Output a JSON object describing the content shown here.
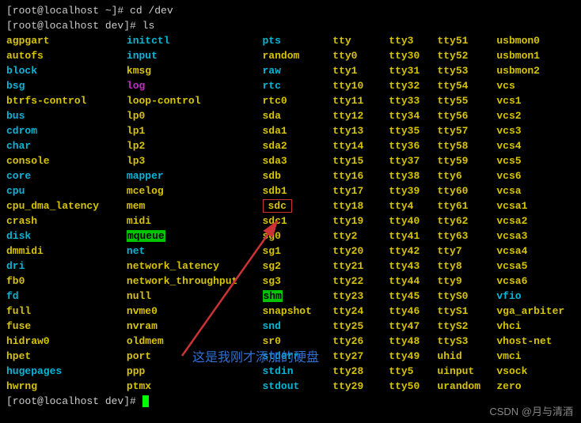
{
  "prompts": [
    {
      "prefix": "[root@localhost ~]# ",
      "cmd": "cd /dev"
    },
    {
      "prefix": "[root@localhost dev]# ",
      "cmd": "ls"
    }
  ],
  "final_prompt": "[root@localhost dev]# ",
  "columns": [
    [
      {
        "t": "agpgart",
        "c": "yellow"
      },
      {
        "t": "autofs",
        "c": "yellow"
      },
      {
        "t": "block",
        "c": "cyan"
      },
      {
        "t": "bsg",
        "c": "cyan"
      },
      {
        "t": "btrfs-control",
        "c": "yellow"
      },
      {
        "t": "bus",
        "c": "cyan"
      },
      {
        "t": "cdrom",
        "c": "cyan"
      },
      {
        "t": "char",
        "c": "cyan"
      },
      {
        "t": "console",
        "c": "yellow"
      },
      {
        "t": "core",
        "c": "cyan"
      },
      {
        "t": "cpu",
        "c": "cyan"
      },
      {
        "t": "cpu_dma_latency",
        "c": "yellow"
      },
      {
        "t": "crash",
        "c": "yellow"
      },
      {
        "t": "disk",
        "c": "cyan"
      },
      {
        "t": "dmmidi",
        "c": "yellow"
      },
      {
        "t": "dri",
        "c": "cyan"
      },
      {
        "t": "fb0",
        "c": "yellow"
      },
      {
        "t": "fd",
        "c": "cyan"
      },
      {
        "t": "full",
        "c": "yellow"
      },
      {
        "t": "fuse",
        "c": "yellow"
      },
      {
        "t": "hidraw0",
        "c": "yellow"
      },
      {
        "t": "hpet",
        "c": "yellow"
      },
      {
        "t": "hugepages",
        "c": "cyan"
      },
      {
        "t": "hwrng",
        "c": "yellow"
      }
    ],
    [
      {
        "t": "initctl",
        "c": "cyan"
      },
      {
        "t": "input",
        "c": "cyan"
      },
      {
        "t": "kmsg",
        "c": "yellow"
      },
      {
        "t": "log",
        "c": "magenta"
      },
      {
        "t": "loop-control",
        "c": "yellow"
      },
      {
        "t": "lp0",
        "c": "yellow"
      },
      {
        "t": "lp1",
        "c": "yellow"
      },
      {
        "t": "lp2",
        "c": "yellow"
      },
      {
        "t": "lp3",
        "c": "yellow"
      },
      {
        "t": "mapper",
        "c": "cyan"
      },
      {
        "t": "mcelog",
        "c": "yellow"
      },
      {
        "t": "mem",
        "c": "yellow"
      },
      {
        "t": "midi",
        "c": "yellow"
      },
      {
        "t": "mqueue",
        "c": "green-bg"
      },
      {
        "t": "net",
        "c": "cyan"
      },
      {
        "t": "network_latency",
        "c": "yellow"
      },
      {
        "t": "network_throughput",
        "c": "yellow"
      },
      {
        "t": "null",
        "c": "yellow"
      },
      {
        "t": "nvme0",
        "c": "yellow"
      },
      {
        "t": "nvram",
        "c": "yellow"
      },
      {
        "t": "oldmem",
        "c": "yellow"
      },
      {
        "t": "port",
        "c": "yellow"
      },
      {
        "t": "ppp",
        "c": "yellow"
      },
      {
        "t": "ptmx",
        "c": "yellow"
      }
    ],
    [
      {
        "t": "pts",
        "c": "cyan"
      },
      {
        "t": "random",
        "c": "yellow"
      },
      {
        "t": "raw",
        "c": "cyan"
      },
      {
        "t": "rtc",
        "c": "cyan"
      },
      {
        "t": "rtc0",
        "c": "yellow"
      },
      {
        "t": "sda",
        "c": "yellow"
      },
      {
        "t": "sda1",
        "c": "yellow"
      },
      {
        "t": "sda2",
        "c": "yellow"
      },
      {
        "t": "sda3",
        "c": "yellow"
      },
      {
        "t": "sdb",
        "c": "yellow"
      },
      {
        "t": "sdb1",
        "c": "yellow"
      },
      {
        "t": "sdc",
        "c": "sdc-box"
      },
      {
        "t": "sdc1",
        "c": "yellow"
      },
      {
        "t": "sg0",
        "c": "yellow"
      },
      {
        "t": "sg1",
        "c": "yellow"
      },
      {
        "t": "sg2",
        "c": "yellow"
      },
      {
        "t": "sg3",
        "c": "yellow"
      },
      {
        "t": "shm",
        "c": "green-bg"
      },
      {
        "t": "snapshot",
        "c": "yellow"
      },
      {
        "t": "snd",
        "c": "cyan"
      },
      {
        "t": "sr0",
        "c": "yellow"
      },
      {
        "t": "stderr",
        "c": "cyan"
      },
      {
        "t": "stdin",
        "c": "cyan"
      },
      {
        "t": "stdout",
        "c": "cyan"
      }
    ],
    [
      {
        "t": "tty",
        "c": "yellow"
      },
      {
        "t": "tty0",
        "c": "yellow"
      },
      {
        "t": "tty1",
        "c": "yellow"
      },
      {
        "t": "tty10",
        "c": "yellow"
      },
      {
        "t": "tty11",
        "c": "yellow"
      },
      {
        "t": "tty12",
        "c": "yellow"
      },
      {
        "t": "tty13",
        "c": "yellow"
      },
      {
        "t": "tty14",
        "c": "yellow"
      },
      {
        "t": "tty15",
        "c": "yellow"
      },
      {
        "t": "tty16",
        "c": "yellow"
      },
      {
        "t": "tty17",
        "c": "yellow"
      },
      {
        "t": "tty18",
        "c": "yellow"
      },
      {
        "t": "tty19",
        "c": "yellow"
      },
      {
        "t": "tty2",
        "c": "yellow"
      },
      {
        "t": "tty20",
        "c": "yellow"
      },
      {
        "t": "tty21",
        "c": "yellow"
      },
      {
        "t": "tty22",
        "c": "yellow"
      },
      {
        "t": "tty23",
        "c": "yellow"
      },
      {
        "t": "tty24",
        "c": "yellow"
      },
      {
        "t": "tty25",
        "c": "yellow"
      },
      {
        "t": "tty26",
        "c": "yellow"
      },
      {
        "t": "tty27",
        "c": "yellow"
      },
      {
        "t": "tty28",
        "c": "yellow"
      },
      {
        "t": "tty29",
        "c": "yellow"
      }
    ],
    [
      {
        "t": "tty3",
        "c": "yellow"
      },
      {
        "t": "tty30",
        "c": "yellow"
      },
      {
        "t": "tty31",
        "c": "yellow"
      },
      {
        "t": "tty32",
        "c": "yellow"
      },
      {
        "t": "tty33",
        "c": "yellow"
      },
      {
        "t": "tty34",
        "c": "yellow"
      },
      {
        "t": "tty35",
        "c": "yellow"
      },
      {
        "t": "tty36",
        "c": "yellow"
      },
      {
        "t": "tty37",
        "c": "yellow"
      },
      {
        "t": "tty38",
        "c": "yellow"
      },
      {
        "t": "tty39",
        "c": "yellow"
      },
      {
        "t": "tty4",
        "c": "yellow"
      },
      {
        "t": "tty40",
        "c": "yellow"
      },
      {
        "t": "tty41",
        "c": "yellow"
      },
      {
        "t": "tty42",
        "c": "yellow"
      },
      {
        "t": "tty43",
        "c": "yellow"
      },
      {
        "t": "tty44",
        "c": "yellow"
      },
      {
        "t": "tty45",
        "c": "yellow"
      },
      {
        "t": "tty46",
        "c": "yellow"
      },
      {
        "t": "tty47",
        "c": "yellow"
      },
      {
        "t": "tty48",
        "c": "yellow"
      },
      {
        "t": "tty49",
        "c": "yellow"
      },
      {
        "t": "tty5",
        "c": "yellow"
      },
      {
        "t": "tty50",
        "c": "yellow"
      }
    ],
    [
      {
        "t": "tty51",
        "c": "yellow"
      },
      {
        "t": "tty52",
        "c": "yellow"
      },
      {
        "t": "tty53",
        "c": "yellow"
      },
      {
        "t": "tty54",
        "c": "yellow"
      },
      {
        "t": "tty55",
        "c": "yellow"
      },
      {
        "t": "tty56",
        "c": "yellow"
      },
      {
        "t": "tty57",
        "c": "yellow"
      },
      {
        "t": "tty58",
        "c": "yellow"
      },
      {
        "t": "tty59",
        "c": "yellow"
      },
      {
        "t": "tty6",
        "c": "yellow"
      },
      {
        "t": "tty60",
        "c": "yellow"
      },
      {
        "t": "tty61",
        "c": "yellow"
      },
      {
        "t": "tty62",
        "c": "yellow"
      },
      {
        "t": "tty63",
        "c": "yellow"
      },
      {
        "t": "tty7",
        "c": "yellow"
      },
      {
        "t": "tty8",
        "c": "yellow"
      },
      {
        "t": "tty9",
        "c": "yellow"
      },
      {
        "t": "ttyS0",
        "c": "yellow"
      },
      {
        "t": "ttyS1",
        "c": "yellow"
      },
      {
        "t": "ttyS2",
        "c": "yellow"
      },
      {
        "t": "ttyS3",
        "c": "yellow"
      },
      {
        "t": "uhid",
        "c": "yellow"
      },
      {
        "t": "uinput",
        "c": "yellow"
      },
      {
        "t": "urandom",
        "c": "yellow"
      }
    ],
    [
      {
        "t": "usbmon0",
        "c": "yellow"
      },
      {
        "t": "usbmon1",
        "c": "yellow"
      },
      {
        "t": "usbmon2",
        "c": "yellow"
      },
      {
        "t": "vcs",
        "c": "yellow"
      },
      {
        "t": "vcs1",
        "c": "yellow"
      },
      {
        "t": "vcs2",
        "c": "yellow"
      },
      {
        "t": "vcs3",
        "c": "yellow"
      },
      {
        "t": "vcs4",
        "c": "yellow"
      },
      {
        "t": "vcs5",
        "c": "yellow"
      },
      {
        "t": "vcs6",
        "c": "yellow"
      },
      {
        "t": "vcsa",
        "c": "yellow"
      },
      {
        "t": "vcsa1",
        "c": "yellow"
      },
      {
        "t": "vcsa2",
        "c": "yellow"
      },
      {
        "t": "vcsa3",
        "c": "yellow"
      },
      {
        "t": "vcsa4",
        "c": "yellow"
      },
      {
        "t": "vcsa5",
        "c": "yellow"
      },
      {
        "t": "vcsa6",
        "c": "yellow"
      },
      {
        "t": "vfio",
        "c": "cyan"
      },
      {
        "t": "vga_arbiter",
        "c": "yellow"
      },
      {
        "t": "vhci",
        "c": "yellow"
      },
      {
        "t": "vhost-net",
        "c": "yellow"
      },
      {
        "t": "vmci",
        "c": "yellow"
      },
      {
        "t": "vsock",
        "c": "yellow"
      },
      {
        "t": "zero",
        "c": "yellow"
      }
    ]
  ],
  "annotation_text": "这是我刚才添加的硬盘",
  "watermark_text": "CSDN @月与清酒"
}
